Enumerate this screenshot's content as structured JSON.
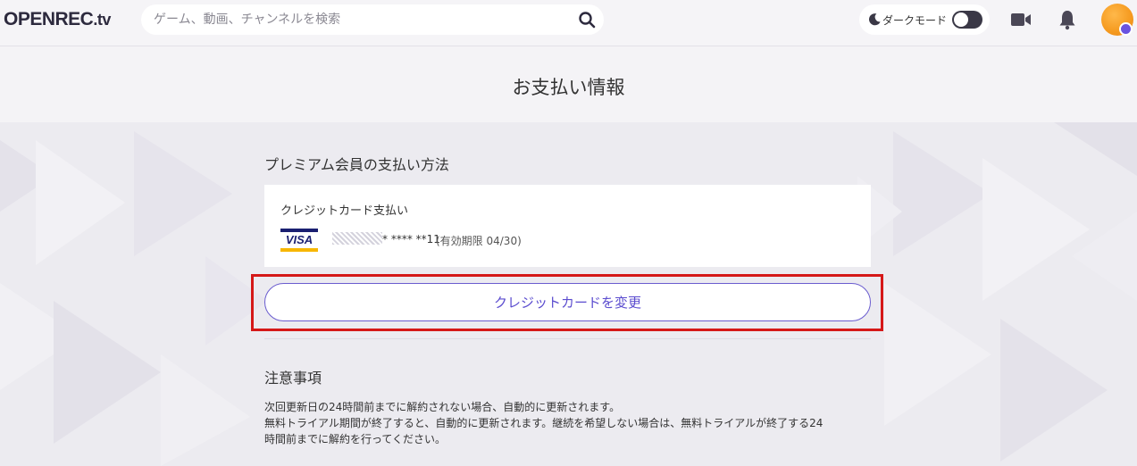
{
  "header": {
    "logo_main": "OPENREC",
    "logo_suffix": ".tv",
    "search_placeholder": "ゲーム、動画、チャンネルを検索",
    "dark_mode_label": "ダークモード",
    "dark_mode_on": false
  },
  "page": {
    "title": "お支払い情報"
  },
  "payment": {
    "section_title": "プレミアム会員の支払い方法",
    "method_label": "クレジットカード支払い",
    "card_brand": "VISA",
    "card_number_masked": "* **** **11",
    "expiry": "(有効期限 04/30)",
    "change_button_label": "クレジットカードを変更"
  },
  "notes": {
    "title": "注意事項",
    "lines": [
      "次回更新日の24時間前までに解約されない場合、自動的に更新されます。",
      "無料トライアル期間が終了すると、自動的に更新されます。継続を希望しない場合は、無料トライアルが終了する24",
      "時間前までに解約を行ってください。"
    ]
  },
  "colors": {
    "accent": "#5b4ccf",
    "highlight": "#d51818",
    "background": "#f4f3f6"
  }
}
